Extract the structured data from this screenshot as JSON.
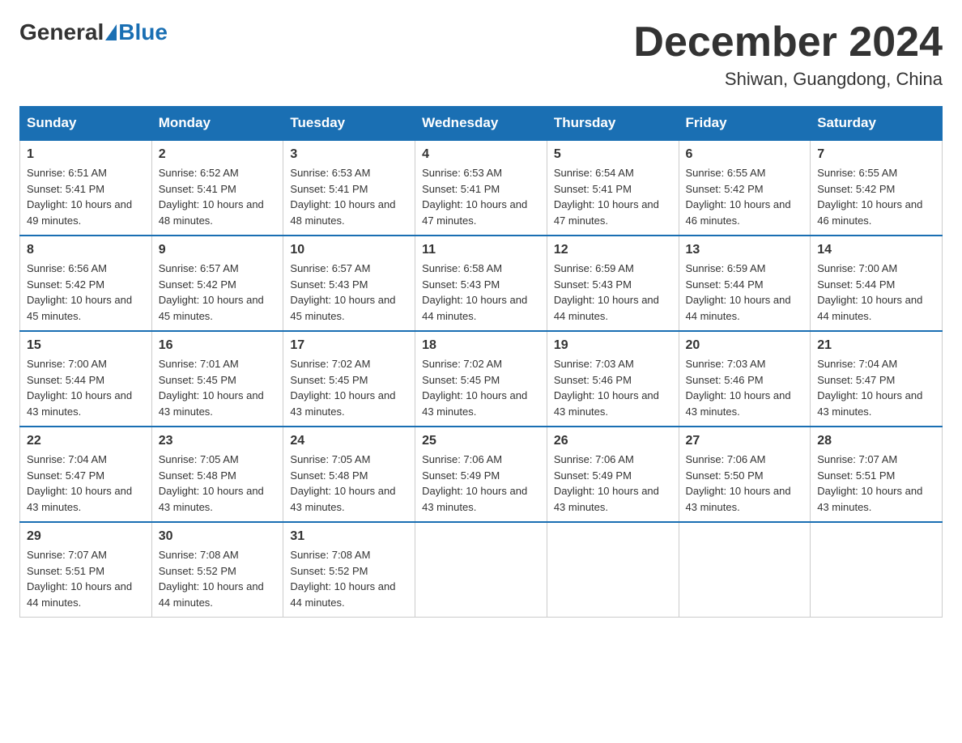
{
  "header": {
    "logo_general": "General",
    "logo_blue": "Blue",
    "month_title": "December 2024",
    "location": "Shiwan, Guangdong, China"
  },
  "days_of_week": [
    "Sunday",
    "Monday",
    "Tuesday",
    "Wednesday",
    "Thursday",
    "Friday",
    "Saturday"
  ],
  "weeks": [
    [
      {
        "day": "1",
        "sunrise": "6:51 AM",
        "sunset": "5:41 PM",
        "daylight": "10 hours and 49 minutes."
      },
      {
        "day": "2",
        "sunrise": "6:52 AM",
        "sunset": "5:41 PM",
        "daylight": "10 hours and 48 minutes."
      },
      {
        "day": "3",
        "sunrise": "6:53 AM",
        "sunset": "5:41 PM",
        "daylight": "10 hours and 48 minutes."
      },
      {
        "day": "4",
        "sunrise": "6:53 AM",
        "sunset": "5:41 PM",
        "daylight": "10 hours and 47 minutes."
      },
      {
        "day": "5",
        "sunrise": "6:54 AM",
        "sunset": "5:41 PM",
        "daylight": "10 hours and 47 minutes."
      },
      {
        "day": "6",
        "sunrise": "6:55 AM",
        "sunset": "5:42 PM",
        "daylight": "10 hours and 46 minutes."
      },
      {
        "day": "7",
        "sunrise": "6:55 AM",
        "sunset": "5:42 PM",
        "daylight": "10 hours and 46 minutes."
      }
    ],
    [
      {
        "day": "8",
        "sunrise": "6:56 AM",
        "sunset": "5:42 PM",
        "daylight": "10 hours and 45 minutes."
      },
      {
        "day": "9",
        "sunrise": "6:57 AM",
        "sunset": "5:42 PM",
        "daylight": "10 hours and 45 minutes."
      },
      {
        "day": "10",
        "sunrise": "6:57 AM",
        "sunset": "5:43 PM",
        "daylight": "10 hours and 45 minutes."
      },
      {
        "day": "11",
        "sunrise": "6:58 AM",
        "sunset": "5:43 PM",
        "daylight": "10 hours and 44 minutes."
      },
      {
        "day": "12",
        "sunrise": "6:59 AM",
        "sunset": "5:43 PM",
        "daylight": "10 hours and 44 minutes."
      },
      {
        "day": "13",
        "sunrise": "6:59 AM",
        "sunset": "5:44 PM",
        "daylight": "10 hours and 44 minutes."
      },
      {
        "day": "14",
        "sunrise": "7:00 AM",
        "sunset": "5:44 PM",
        "daylight": "10 hours and 44 minutes."
      }
    ],
    [
      {
        "day": "15",
        "sunrise": "7:00 AM",
        "sunset": "5:44 PM",
        "daylight": "10 hours and 43 minutes."
      },
      {
        "day": "16",
        "sunrise": "7:01 AM",
        "sunset": "5:45 PM",
        "daylight": "10 hours and 43 minutes."
      },
      {
        "day": "17",
        "sunrise": "7:02 AM",
        "sunset": "5:45 PM",
        "daylight": "10 hours and 43 minutes."
      },
      {
        "day": "18",
        "sunrise": "7:02 AM",
        "sunset": "5:45 PM",
        "daylight": "10 hours and 43 minutes."
      },
      {
        "day": "19",
        "sunrise": "7:03 AM",
        "sunset": "5:46 PM",
        "daylight": "10 hours and 43 minutes."
      },
      {
        "day": "20",
        "sunrise": "7:03 AM",
        "sunset": "5:46 PM",
        "daylight": "10 hours and 43 minutes."
      },
      {
        "day": "21",
        "sunrise": "7:04 AM",
        "sunset": "5:47 PM",
        "daylight": "10 hours and 43 minutes."
      }
    ],
    [
      {
        "day": "22",
        "sunrise": "7:04 AM",
        "sunset": "5:47 PM",
        "daylight": "10 hours and 43 minutes."
      },
      {
        "day": "23",
        "sunrise": "7:05 AM",
        "sunset": "5:48 PM",
        "daylight": "10 hours and 43 minutes."
      },
      {
        "day": "24",
        "sunrise": "7:05 AM",
        "sunset": "5:48 PM",
        "daylight": "10 hours and 43 minutes."
      },
      {
        "day": "25",
        "sunrise": "7:06 AM",
        "sunset": "5:49 PM",
        "daylight": "10 hours and 43 minutes."
      },
      {
        "day": "26",
        "sunrise": "7:06 AM",
        "sunset": "5:49 PM",
        "daylight": "10 hours and 43 minutes."
      },
      {
        "day": "27",
        "sunrise": "7:06 AM",
        "sunset": "5:50 PM",
        "daylight": "10 hours and 43 minutes."
      },
      {
        "day": "28",
        "sunrise": "7:07 AM",
        "sunset": "5:51 PM",
        "daylight": "10 hours and 43 minutes."
      }
    ],
    [
      {
        "day": "29",
        "sunrise": "7:07 AM",
        "sunset": "5:51 PM",
        "daylight": "10 hours and 44 minutes."
      },
      {
        "day": "30",
        "sunrise": "7:08 AM",
        "sunset": "5:52 PM",
        "daylight": "10 hours and 44 minutes."
      },
      {
        "day": "31",
        "sunrise": "7:08 AM",
        "sunset": "5:52 PM",
        "daylight": "10 hours and 44 minutes."
      },
      null,
      null,
      null,
      null
    ]
  ]
}
